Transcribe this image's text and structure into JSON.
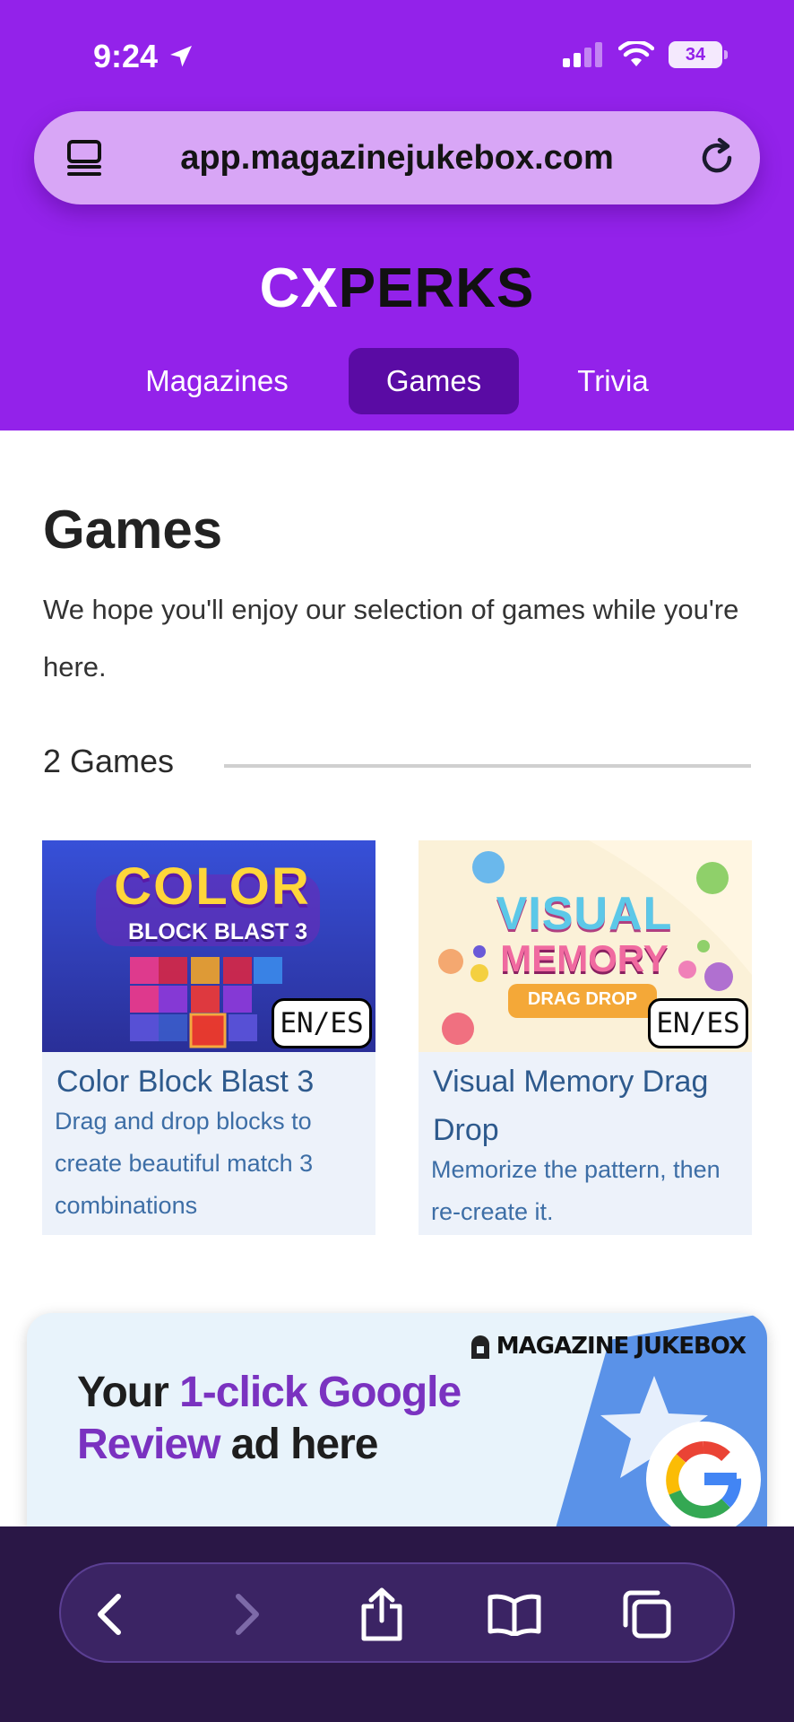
{
  "status_bar": {
    "time": "9:24",
    "battery": "34"
  },
  "browser": {
    "url": "app.magazinejukebox.com"
  },
  "brand": {
    "logo_part1": "CX",
    "logo_part2": "PERKS"
  },
  "nav": {
    "items": [
      {
        "label": "Magazines"
      },
      {
        "label": "Games"
      },
      {
        "label": "Trivia"
      }
    ],
    "active": "Games"
  },
  "page": {
    "title": "Games",
    "description": "We hope you'll enjoy our selection of games while you're here.",
    "count_label": "2 Games"
  },
  "games": [
    {
      "title": "Color Block Blast 3",
      "description": "Drag and drop blocks to create beautiful match 3 combinations",
      "lang": "EN/ES",
      "art_line1": "COLOR",
      "art_line2": "BLOCK BLAST 3"
    },
    {
      "title": "Visual Memory Drag Drop",
      "description": "Memorize the pattern, then re-create it.",
      "lang": "EN/ES",
      "art_line1": "VISUAL",
      "art_line2": "MEMORY",
      "art_line3": "DRAG DROP"
    }
  ],
  "ad": {
    "text_part1": "Your ",
    "text_highlight1": "1-click Google",
    "text_highlight2": "Review",
    "text_part2": " ad here",
    "brand": "MAGAZINE JUKEBOX"
  },
  "colors": {
    "header_purple": "#9322ea",
    "nav_active": "#5a0ba4",
    "card_bg": "#edf2fa",
    "card_title": "#2e5a8d",
    "toolbar": "#2a1746"
  },
  "icons": [
    "location-arrow-icon",
    "cellular-signal-icon",
    "wifi-icon",
    "battery-icon",
    "tabs-icon",
    "reload-icon",
    "back-icon",
    "forward-icon",
    "share-icon",
    "bookmarks-icon",
    "tabs-overview-icon",
    "google-logo-icon",
    "jukebox-icon"
  ]
}
